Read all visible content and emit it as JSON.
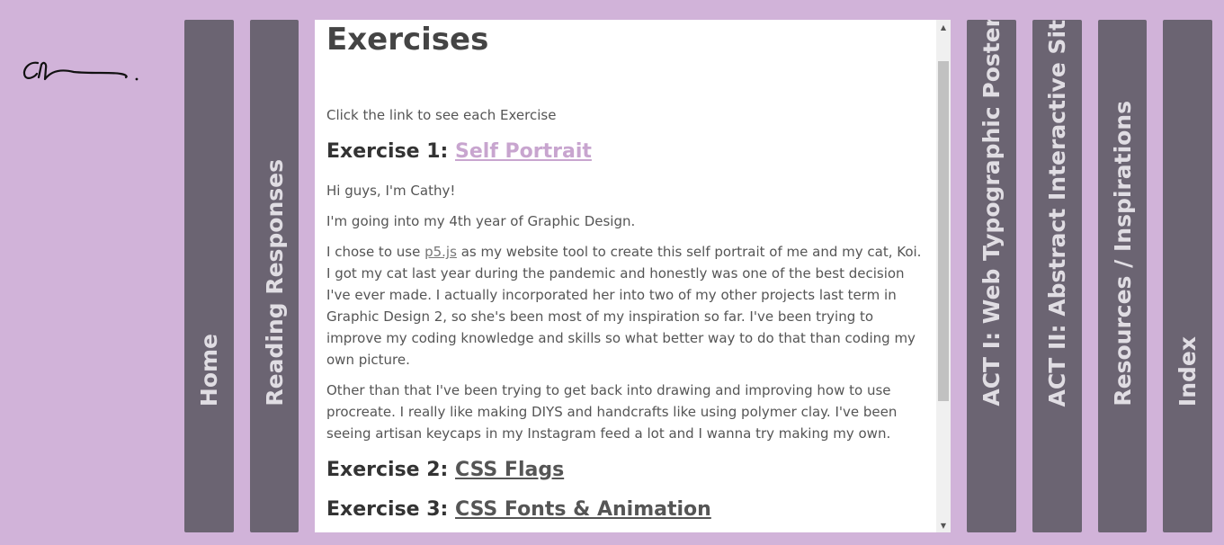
{
  "nav": {
    "home": "Home",
    "reading": "Reading Responses",
    "act1": "ACT I: Web Typographic Poster",
    "act2": "ACT II: Abstract Interactive Site",
    "resources": "Resources / Inspirations",
    "index": "Index"
  },
  "main": {
    "title": "Exercises",
    "intro": "Click the link to see each Exercise",
    "ex1": {
      "prefix": "Exercise 1: ",
      "link": "Self Portrait"
    },
    "p1": "Hi guys, I'm Cathy!",
    "p2": "I'm going into my 4th year of Graphic Design.",
    "p3_before": "I chose to use ",
    "p3_link": "p5.js",
    "p3_after": " as my website tool to create this self portrait of me and my cat, Koi. I got my cat last year during the pandemic and honestly was one of the best decision I've ever made. I actually incorporated her into two of my other projects last term in Graphic Design 2, so she's been most of my inspiration so far. I've been trying to improve my coding knowledge and skills so what better way to do that than coding my own picture.",
    "p4": "Other than that I've been trying to get back into drawing and improving how to use procreate. I really like making DIYS and handcrafts like using polymer clay. I've been seeing artisan keycaps in my Instagram feed a lot and I wanna try making my own.",
    "ex2": {
      "prefix": "Exercise 2: ",
      "link": "CSS Flags"
    },
    "ex3": {
      "prefix": "Exercise 3: ",
      "link": "CSS Fonts & Animation"
    }
  },
  "icons": {
    "scroll_up": "triangle-up",
    "scroll_down": "triangle-down"
  },
  "colors": {
    "background": "#d1b3d9",
    "nav": "#6b6472",
    "link": "#c8a5cf"
  }
}
